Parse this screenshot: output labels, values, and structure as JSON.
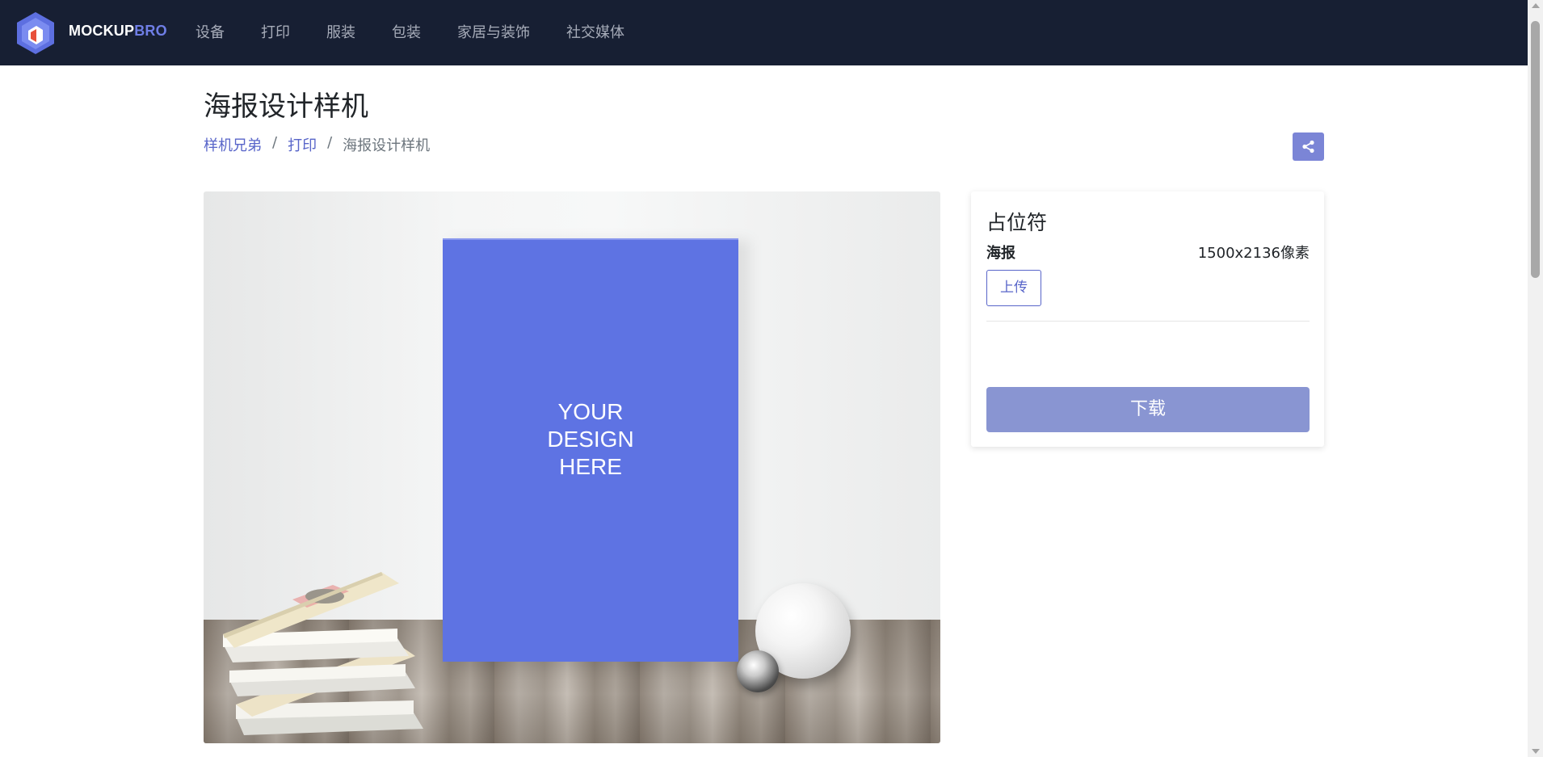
{
  "navbar": {
    "brand_main": "MOCKUP",
    "brand_accent": "BRO",
    "links": [
      "设备",
      "打印",
      "服装",
      "包装",
      "家居与装饰",
      "社交媒体"
    ]
  },
  "page": {
    "title": "海报设计样机",
    "breadcrumb": [
      "样机兄弟",
      "打印",
      "海报设计样机"
    ],
    "breadcrumb_separator": "/"
  },
  "mockup": {
    "poster_text": [
      "YOUR",
      "DESIGN",
      "HERE"
    ],
    "poster_color": "#5e73e3"
  },
  "panel": {
    "title": "占位符",
    "layer_name": "海报",
    "layer_size": "1500x2136像素",
    "upload_label": "上传",
    "download_label": "下载"
  },
  "colors": {
    "navbar_bg": "#171f33",
    "accent": "#5865c9",
    "download_bg": "#8995d2"
  },
  "icons": [
    "logo-icon",
    "share-icon"
  ]
}
